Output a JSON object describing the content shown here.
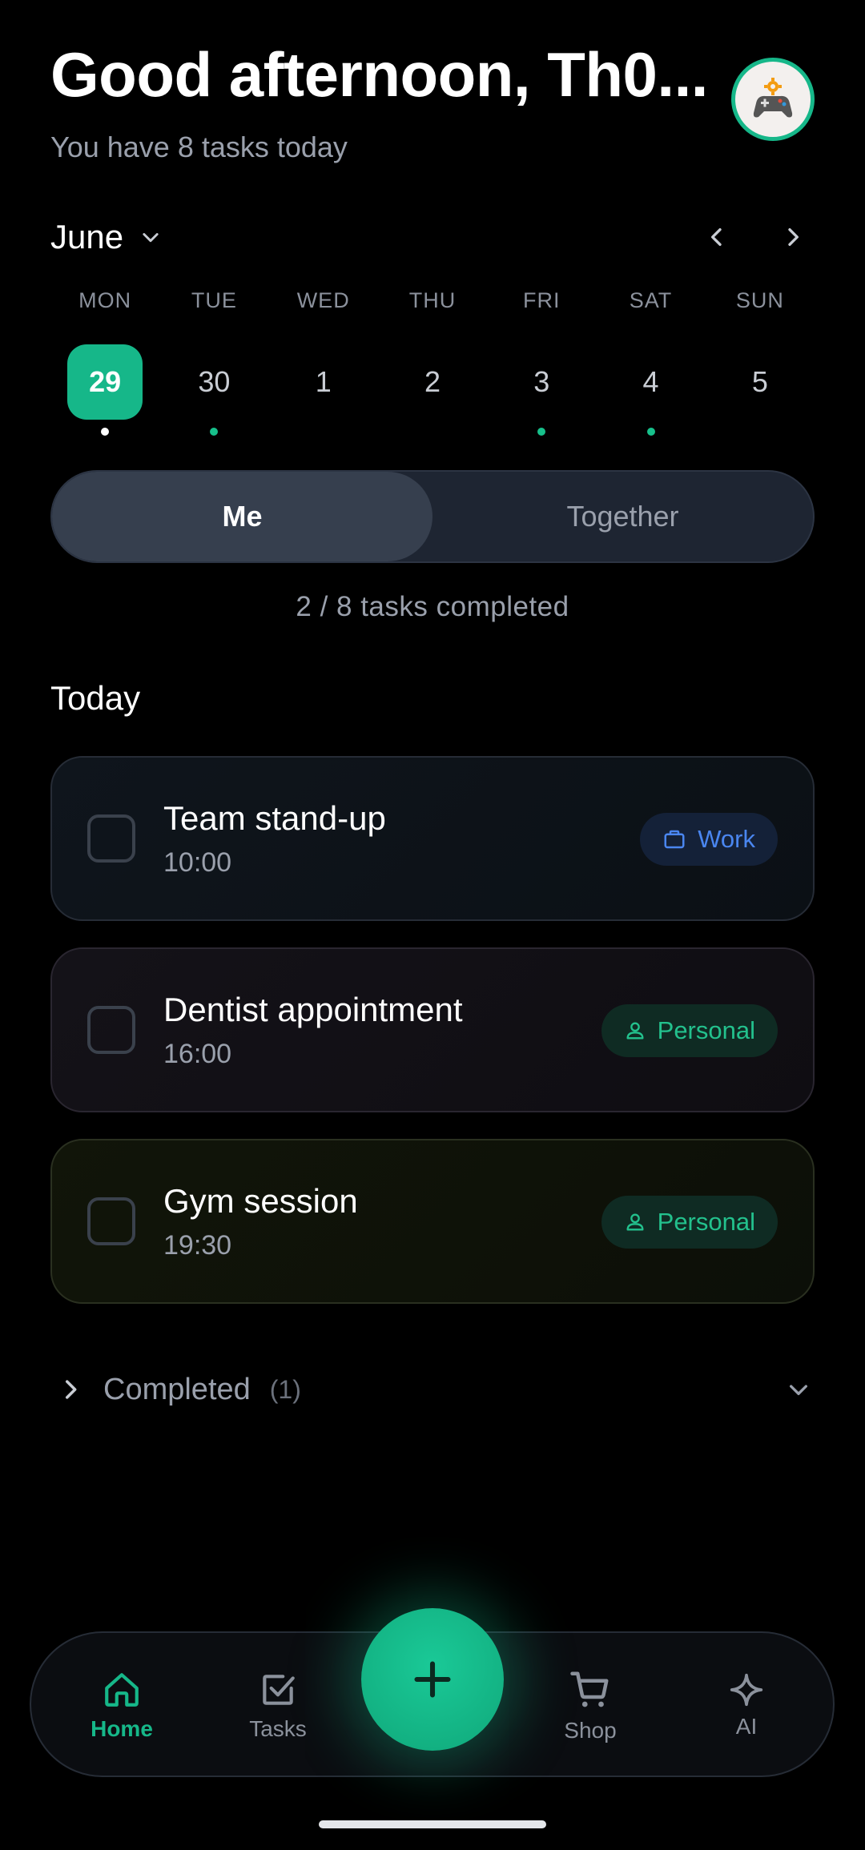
{
  "header": {
    "greeting": "Good afternoon, Th0...",
    "subtitle": "You have 8 tasks today",
    "avatar_icon": "gamepad-gear-icon"
  },
  "calendar": {
    "month": "June",
    "days": [
      {
        "dow": "MON",
        "date": "29",
        "active": true,
        "dot": "white"
      },
      {
        "dow": "TUE",
        "date": "30",
        "active": false,
        "dot": "green"
      },
      {
        "dow": "WED",
        "date": "1",
        "active": false,
        "dot": "none"
      },
      {
        "dow": "THU",
        "date": "2",
        "active": false,
        "dot": "none"
      },
      {
        "dow": "FRI",
        "date": "3",
        "active": false,
        "dot": "green"
      },
      {
        "dow": "SAT",
        "date": "4",
        "active": false,
        "dot": "green"
      },
      {
        "dow": "SUN",
        "date": "5",
        "active": false,
        "dot": "none"
      }
    ]
  },
  "toggle": {
    "me": "Me",
    "together": "Together",
    "selected": "Me"
  },
  "progress_text": "2 / 8 tasks completed",
  "today": {
    "title": "Today",
    "tasks": [
      {
        "title": "Team stand-up",
        "time": "10:00",
        "tag": "Work",
        "tag_icon": "briefcase-icon"
      },
      {
        "title": "Dentist appointment",
        "time": "16:00",
        "tag": "Personal",
        "tag_icon": "person-icon"
      },
      {
        "title": "Gym session",
        "time": "19:30",
        "tag": "Personal",
        "tag_icon": "person-icon"
      }
    ]
  },
  "completed": {
    "label": "Completed",
    "count": "(1)"
  },
  "bottom_nav": {
    "items": [
      {
        "label": "Home",
        "icon": "home-icon",
        "active": true
      },
      {
        "label": "Tasks",
        "icon": "checkbox-icon",
        "active": false
      },
      {
        "label": "Shop",
        "icon": "cart-icon",
        "active": false
      },
      {
        "label": "AI",
        "icon": "sparkle-icon",
        "active": false
      }
    ],
    "fab_icon": "plus-icon"
  },
  "colors": {
    "accent": "#16b789",
    "work": "#4a86f0",
    "personal": "#23c18d",
    "background": "#000000"
  }
}
